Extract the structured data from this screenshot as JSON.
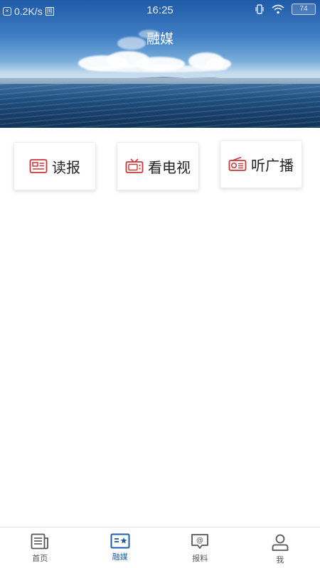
{
  "status_bar": {
    "network_speed": "0.2K/s",
    "time": "16:25",
    "battery": "74"
  },
  "header": {
    "title": "融媒"
  },
  "media_cards": [
    {
      "label": "读报",
      "icon": "newspaper-icon"
    },
    {
      "label": "看电视",
      "icon": "tv-icon"
    },
    {
      "label": "听广播",
      "icon": "radio-icon"
    }
  ],
  "tabs": [
    {
      "label": "首页",
      "icon": "news-icon",
      "active": false
    },
    {
      "label": "融媒",
      "icon": "media-card-icon",
      "active": true
    },
    {
      "label": "报料",
      "icon": "report-chat-icon",
      "active": false
    },
    {
      "label": "我",
      "icon": "user-icon",
      "active": false
    }
  ],
  "colors": {
    "accent": "#1d5fa3",
    "card_icon": "#c9373a",
    "tab_icon_inactive": "#555555"
  }
}
